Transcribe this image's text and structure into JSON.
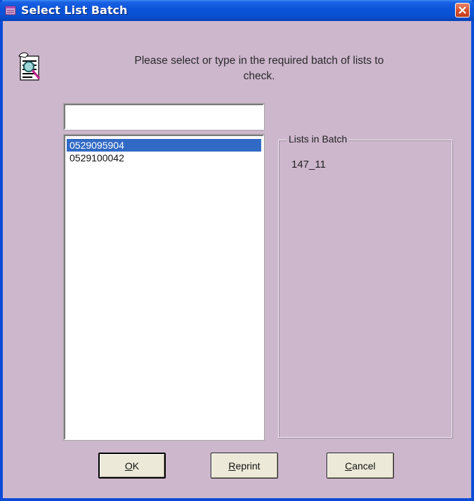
{
  "window": {
    "title": "Select List Batch"
  },
  "prompt": {
    "line1": "Please select or type in the required batch of lists to",
    "line2": "check."
  },
  "batch_input": {
    "value": ""
  },
  "batch_list": {
    "items": [
      "0529095904",
      "0529100042"
    ],
    "selected_index": 0
  },
  "lists_in_batch": {
    "label": "Lists in Batch",
    "items": [
      "147_11"
    ]
  },
  "buttons": {
    "ok": {
      "accel": "O",
      "rest": "K"
    },
    "reprint": {
      "accel": "R",
      "rest": "eprint"
    },
    "cancel": {
      "accel": "C",
      "rest": "ancel"
    }
  },
  "colors": {
    "background": "#cdb7cd",
    "titlebar": "#0a53d8",
    "selection": "#316ac5",
    "close_button": "#d6522f"
  },
  "icons": {
    "title": "list-batch-app-icon",
    "header": "document-magnifier-icon",
    "close": "close-icon"
  }
}
